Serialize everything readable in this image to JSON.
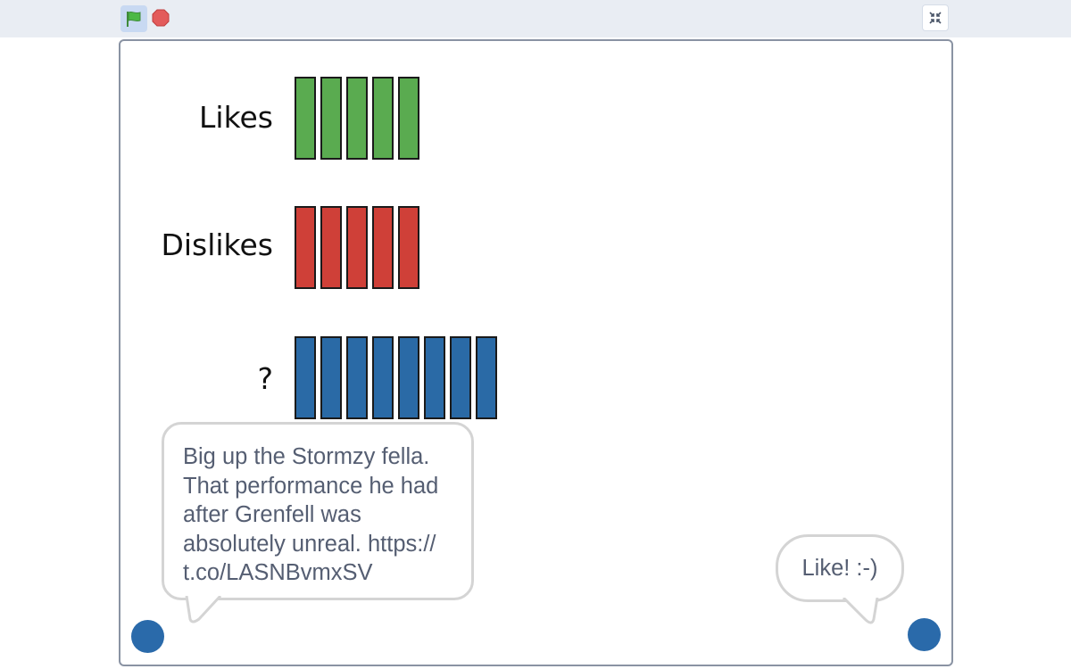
{
  "toolbar": {
    "green_flag_icon": "green-flag-icon",
    "stop_icon": "stop-sign-icon",
    "fullscreen_icon": "exit-fullscreen-icon"
  },
  "chart_data": {
    "type": "bar",
    "categories": [
      "Likes",
      "Dislikes",
      "?"
    ],
    "values": [
      5,
      5,
      8
    ],
    "colors": [
      "#5aab50",
      "#cf4038",
      "#2a6aa6"
    ]
  },
  "bubbles": {
    "left_text": "Big up the Stormzy fella. That performance he had after Grenfell was absolutely unreal. https:// t.co/LASNBvmxSV",
    "right_text": "Like! :-)"
  },
  "colors": {
    "topbar": "#e9edf3",
    "sprite": "#2a6aaa",
    "bubble_border": "#d4d4d4",
    "bubble_text": "#555e72"
  }
}
